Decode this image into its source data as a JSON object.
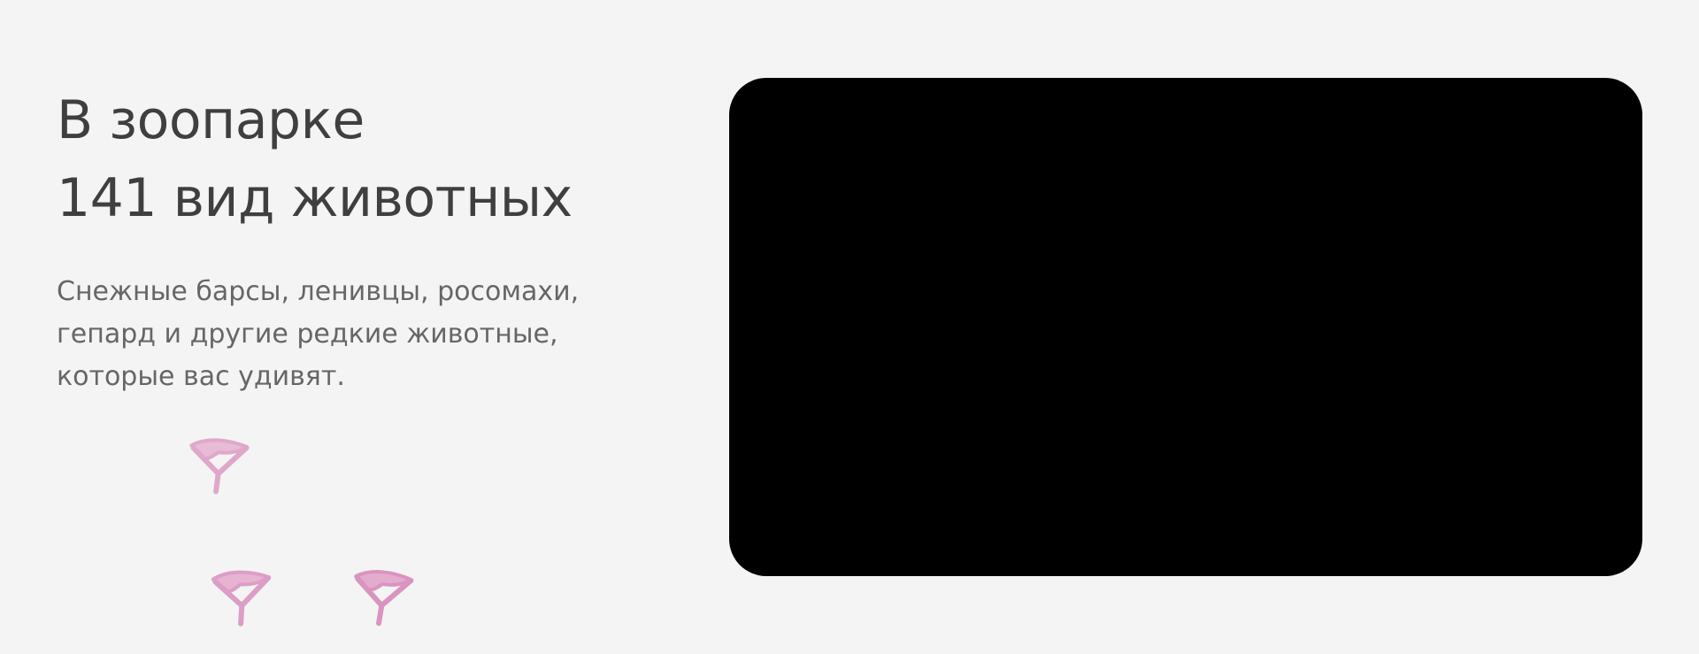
{
  "hero": {
    "headline": {
      "line1": "В зоопарке",
      "line2": "141 вид животных"
    },
    "description": {
      "line1": "Снежные барсы, ленивцы, росомахи,",
      "line2": "гепард и другие редкие животные,",
      "line3": "которые вас удивят."
    }
  },
  "video": {
    "background": "#000000"
  },
  "decor": {
    "footprint_icon": "bird-footprint-icon",
    "footprint_color": "#e5a8cd"
  }
}
